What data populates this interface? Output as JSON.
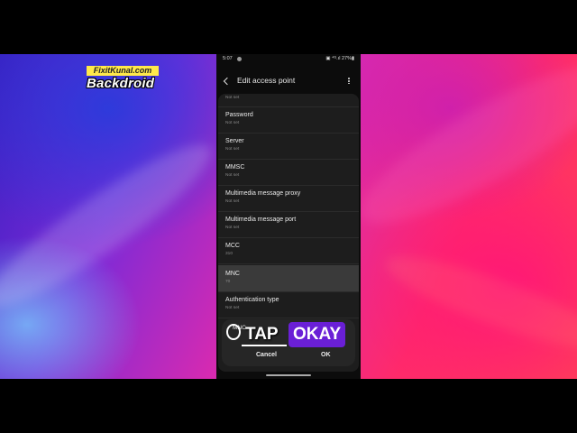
{
  "watermark": {
    "site": "FixitKunal.com",
    "brand": "Backdroid"
  },
  "status_bar": {
    "time": "5:07",
    "right": "▣ ⁴ᴳ.ıl 27%▮"
  },
  "app_bar": {
    "title": "Edit access point"
  },
  "fields": [
    {
      "label": "",
      "value": "Not set"
    },
    {
      "label": "Password",
      "value": "Not set"
    },
    {
      "label": "Server",
      "value": "Not set"
    },
    {
      "label": "MMSC",
      "value": "Not set"
    },
    {
      "label": "Multimedia message proxy",
      "value": "Not set"
    },
    {
      "label": "Multimedia message port",
      "value": "Not set"
    },
    {
      "label": "MCC",
      "value": "310"
    },
    {
      "label": "MNC",
      "value": "70"
    },
    {
      "label": "Authentication type",
      "value": "Not set"
    }
  ],
  "dialog": {
    "label": "MNC",
    "cancel": "Cancel",
    "ok": "OK"
  },
  "caption": {
    "tap": "TAP",
    "okay": "OKAY"
  },
  "colors": {
    "highlight_row": "#3a3a3a",
    "caption_accent": "#6a1fd6",
    "logo_yellow": "#ffe94a"
  }
}
